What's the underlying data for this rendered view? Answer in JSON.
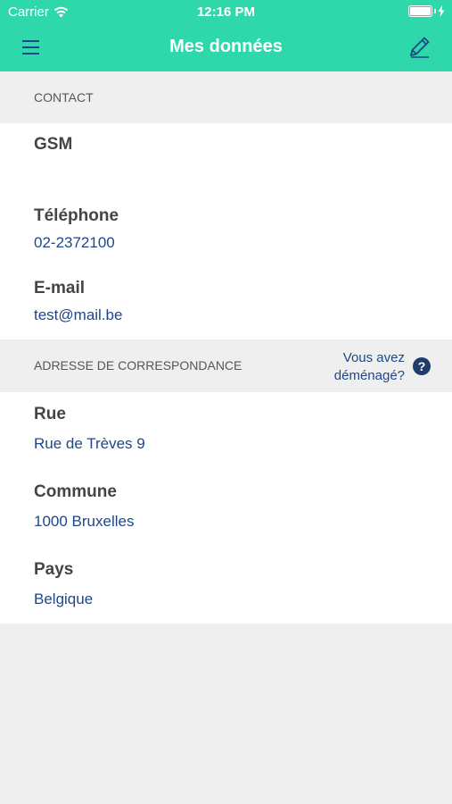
{
  "status_bar": {
    "carrier": "Carrier",
    "time": "12:16 PM"
  },
  "nav": {
    "title": "Mes données",
    "menu_icon": "hamburger-menu-icon",
    "edit_icon": "pencil-edit-icon"
  },
  "contact": {
    "header": "CONTACT",
    "fields": [
      {
        "label": "GSM",
        "value": ""
      },
      {
        "label": "Téléphone",
        "value": "02-2372100"
      },
      {
        "label": "E-mail",
        "value": "test@mail.be"
      }
    ]
  },
  "address": {
    "header": "ADRESSE DE CORRESPONDANCE",
    "moved_line1": "Vous avez",
    "moved_line2": "déménagé?",
    "help_icon": "question-circle-icon",
    "fields": [
      {
        "label": "Rue",
        "value": "Rue de Trèves 9"
      },
      {
        "label": "Commune",
        "value": "1000 Bruxelles"
      },
      {
        "label": "Pays",
        "value": "Belgique"
      }
    ]
  },
  "colors": {
    "header_bg": "#2ed8aa",
    "value_text": "#1f4788",
    "label_text": "#444444",
    "section_bg": "#efefef"
  }
}
